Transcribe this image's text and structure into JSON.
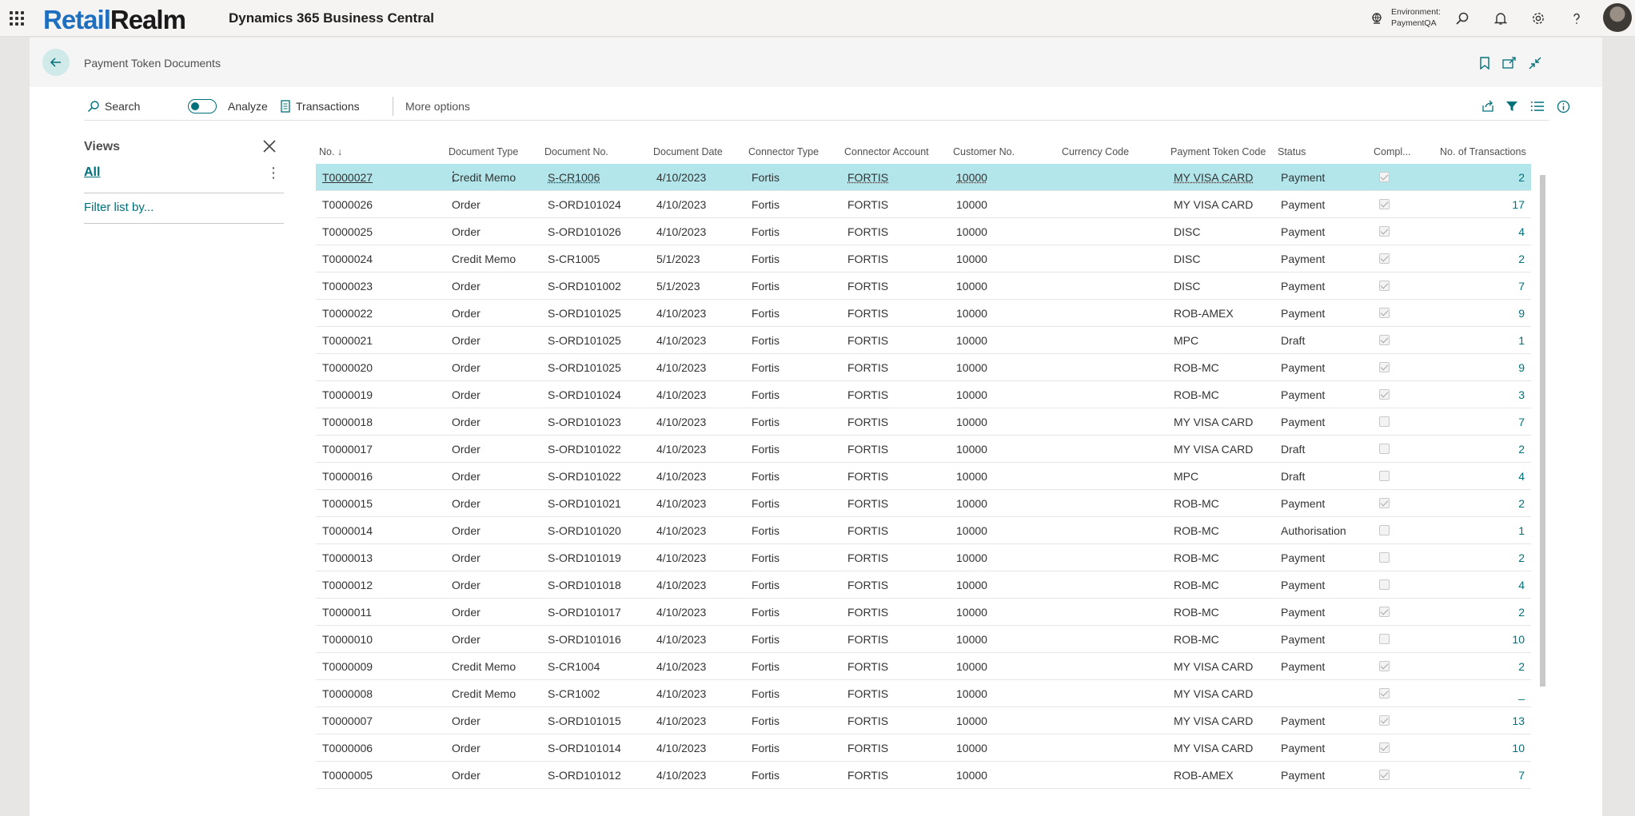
{
  "topbar": {
    "logo_part1": "Retail",
    "logo_part2": "Realm",
    "app_title": "Dynamics 365 Business Central",
    "env_label": "Environment:",
    "env_value": "PaymentQA",
    "icons": [
      "waffle-icon",
      "environment-icon",
      "search-icon",
      "bell-icon",
      "gear-icon",
      "help-icon",
      "avatar"
    ]
  },
  "page": {
    "title": "Payment Token Documents"
  },
  "actions": {
    "search": "Search",
    "analyze": "Analyze",
    "transactions": "Transactions",
    "more": "More options"
  },
  "views": {
    "title": "Views",
    "all": "All",
    "filter": "Filter list by..."
  },
  "columns": {
    "no": "No. ↓",
    "doc_type": "Document Type",
    "doc_no": "Document No.",
    "doc_date": "Document Date",
    "conn_type": "Connector Type",
    "conn_account": "Connector Account",
    "cust_no": "Customer No.",
    "currency": "Currency Code",
    "token_code": "Payment Token Code",
    "status": "Status",
    "compl": "Compl...",
    "num_trans": "No. of Transactions"
  },
  "rows": [
    {
      "no": "T0000027",
      "type": "Credit Memo",
      "docno": "S-CR1006",
      "date": "4/10/2023",
      "ctype": "Fortis",
      "cacct": "FORTIS",
      "cust": "10000",
      "cur": "",
      "token": "MY VISA CARD",
      "status": "Payment",
      "compl": true,
      "trans": "2"
    },
    {
      "no": "T0000026",
      "type": "Order",
      "docno": "S-ORD101024",
      "date": "4/10/2023",
      "ctype": "Fortis",
      "cacct": "FORTIS",
      "cust": "10000",
      "cur": "",
      "token": "MY VISA CARD",
      "status": "Payment",
      "compl": true,
      "trans": "17"
    },
    {
      "no": "T0000025",
      "type": "Order",
      "docno": "S-ORD101026",
      "date": "4/10/2023",
      "ctype": "Fortis",
      "cacct": "FORTIS",
      "cust": "10000",
      "cur": "",
      "token": "DISC",
      "status": "Payment",
      "compl": true,
      "trans": "4"
    },
    {
      "no": "T0000024",
      "type": "Credit Memo",
      "docno": "S-CR1005",
      "date": "5/1/2023",
      "ctype": "Fortis",
      "cacct": "FORTIS",
      "cust": "10000",
      "cur": "",
      "token": "DISC",
      "status": "Payment",
      "compl": true,
      "trans": "2"
    },
    {
      "no": "T0000023",
      "type": "Order",
      "docno": "S-ORD101002",
      "date": "5/1/2023",
      "ctype": "Fortis",
      "cacct": "FORTIS",
      "cust": "10000",
      "cur": "",
      "token": "DISC",
      "status": "Payment",
      "compl": true,
      "trans": "7"
    },
    {
      "no": "T0000022",
      "type": "Order",
      "docno": "S-ORD101025",
      "date": "4/10/2023",
      "ctype": "Fortis",
      "cacct": "FORTIS",
      "cust": "10000",
      "cur": "",
      "token": "ROB-AMEX",
      "status": "Payment",
      "compl": true,
      "trans": "9"
    },
    {
      "no": "T0000021",
      "type": "Order",
      "docno": "S-ORD101025",
      "date": "4/10/2023",
      "ctype": "Fortis",
      "cacct": "FORTIS",
      "cust": "10000",
      "cur": "",
      "token": "MPC",
      "status": "Draft",
      "compl": true,
      "trans": "1"
    },
    {
      "no": "T0000020",
      "type": "Order",
      "docno": "S-ORD101025",
      "date": "4/10/2023",
      "ctype": "Fortis",
      "cacct": "FORTIS",
      "cust": "10000",
      "cur": "",
      "token": "ROB-MC",
      "status": "Payment",
      "compl": true,
      "trans": "9"
    },
    {
      "no": "T0000019",
      "type": "Order",
      "docno": "S-ORD101024",
      "date": "4/10/2023",
      "ctype": "Fortis",
      "cacct": "FORTIS",
      "cust": "10000",
      "cur": "",
      "token": "ROB-MC",
      "status": "Payment",
      "compl": true,
      "trans": "3"
    },
    {
      "no": "T0000018",
      "type": "Order",
      "docno": "S-ORD101023",
      "date": "4/10/2023",
      "ctype": "Fortis",
      "cacct": "FORTIS",
      "cust": "10000",
      "cur": "",
      "token": "MY VISA CARD",
      "status": "Payment",
      "compl": false,
      "trans": "7"
    },
    {
      "no": "T0000017",
      "type": "Order",
      "docno": "S-ORD101022",
      "date": "4/10/2023",
      "ctype": "Fortis",
      "cacct": "FORTIS",
      "cust": "10000",
      "cur": "",
      "token": "MY VISA CARD",
      "status": "Draft",
      "compl": false,
      "trans": "2"
    },
    {
      "no": "T0000016",
      "type": "Order",
      "docno": "S-ORD101022",
      "date": "4/10/2023",
      "ctype": "Fortis",
      "cacct": "FORTIS",
      "cust": "10000",
      "cur": "",
      "token": "MPC",
      "status": "Draft",
      "compl": false,
      "trans": "4"
    },
    {
      "no": "T0000015",
      "type": "Order",
      "docno": "S-ORD101021",
      "date": "4/10/2023",
      "ctype": "Fortis",
      "cacct": "FORTIS",
      "cust": "10000",
      "cur": "",
      "token": "ROB-MC",
      "status": "Payment",
      "compl": true,
      "trans": "2"
    },
    {
      "no": "T0000014",
      "type": "Order",
      "docno": "S-ORD101020",
      "date": "4/10/2023",
      "ctype": "Fortis",
      "cacct": "FORTIS",
      "cust": "10000",
      "cur": "",
      "token": "ROB-MC",
      "status": "Authorisation",
      "compl": false,
      "trans": "1"
    },
    {
      "no": "T0000013",
      "type": "Order",
      "docno": "S-ORD101019",
      "date": "4/10/2023",
      "ctype": "Fortis",
      "cacct": "FORTIS",
      "cust": "10000",
      "cur": "",
      "token": "ROB-MC",
      "status": "Payment",
      "compl": false,
      "trans": "2"
    },
    {
      "no": "T0000012",
      "type": "Order",
      "docno": "S-ORD101018",
      "date": "4/10/2023",
      "ctype": "Fortis",
      "cacct": "FORTIS",
      "cust": "10000",
      "cur": "",
      "token": "ROB-MC",
      "status": "Payment",
      "compl": false,
      "trans": "4"
    },
    {
      "no": "T0000011",
      "type": "Order",
      "docno": "S-ORD101017",
      "date": "4/10/2023",
      "ctype": "Fortis",
      "cacct": "FORTIS",
      "cust": "10000",
      "cur": "",
      "token": "ROB-MC",
      "status": "Payment",
      "compl": true,
      "trans": "2"
    },
    {
      "no": "T0000010",
      "type": "Order",
      "docno": "S-ORD101016",
      "date": "4/10/2023",
      "ctype": "Fortis",
      "cacct": "FORTIS",
      "cust": "10000",
      "cur": "",
      "token": "ROB-MC",
      "status": "Payment",
      "compl": false,
      "trans": "10"
    },
    {
      "no": "T0000009",
      "type": "Credit Memo",
      "docno": "S-CR1004",
      "date": "4/10/2023",
      "ctype": "Fortis",
      "cacct": "FORTIS",
      "cust": "10000",
      "cur": "",
      "token": "MY VISA CARD",
      "status": "Payment",
      "compl": true,
      "trans": "2"
    },
    {
      "no": "T0000008",
      "type": "Credit Memo",
      "docno": "S-CR1002",
      "date": "4/10/2023",
      "ctype": "Fortis",
      "cacct": "FORTIS",
      "cust": "10000",
      "cur": "",
      "token": "MY VISA CARD",
      "status": "",
      "compl": true,
      "trans": "_"
    },
    {
      "no": "T0000007",
      "type": "Order",
      "docno": "S-ORD101015",
      "date": "4/10/2023",
      "ctype": "Fortis",
      "cacct": "FORTIS",
      "cust": "10000",
      "cur": "",
      "token": "MY VISA CARD",
      "status": "Payment",
      "compl": true,
      "trans": "13"
    },
    {
      "no": "T0000006",
      "type": "Order",
      "docno": "S-ORD101014",
      "date": "4/10/2023",
      "ctype": "Fortis",
      "cacct": "FORTIS",
      "cust": "10000",
      "cur": "",
      "token": "MY VISA CARD",
      "status": "Payment",
      "compl": true,
      "trans": "10"
    },
    {
      "no": "T0000005",
      "type": "Order",
      "docno": "S-ORD101012",
      "date": "4/10/2023",
      "ctype": "Fortis",
      "cacct": "FORTIS",
      "cust": "10000",
      "cur": "",
      "token": "ROB-AMEX",
      "status": "Payment",
      "compl": true,
      "trans": "7"
    }
  ],
  "colors": {
    "accent": "#00707a",
    "selected_row": "#b2e6eb",
    "brand_blue": "#1f6fc1"
  }
}
